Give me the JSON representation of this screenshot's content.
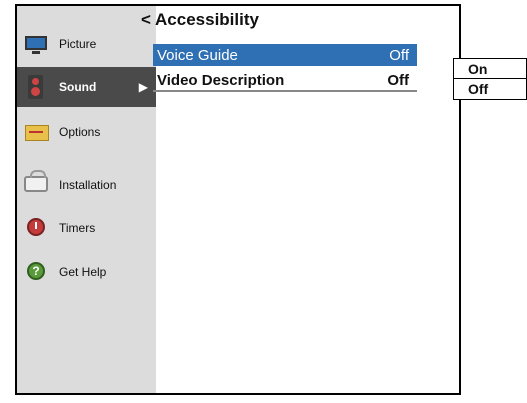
{
  "sidebar": {
    "items": [
      {
        "label": "Picture",
        "icon": "tv-icon"
      },
      {
        "label": "Sound",
        "icon": "speaker-icon",
        "active": true,
        "arrow": "▶"
      },
      {
        "label": "Options",
        "icon": "options-icon"
      },
      {
        "label": "Installation",
        "icon": "installation-icon"
      },
      {
        "label": "Timers",
        "icon": "timer-icon"
      },
      {
        "label": "Get Help",
        "icon": "help-icon",
        "glyph": "?"
      }
    ]
  },
  "panel": {
    "title": "< Accessibility",
    "rows": [
      {
        "label": "Voice Guide",
        "value": "Off",
        "selected": true
      },
      {
        "label": "Video Description",
        "value": "Off"
      }
    ]
  },
  "dropdown": {
    "options": [
      "On",
      "Off"
    ]
  },
  "colors": {
    "selection_blue": "#2f6fb3",
    "sidebar_bg": "#dcdcdc",
    "active_item_bg": "#4a4a4a"
  }
}
